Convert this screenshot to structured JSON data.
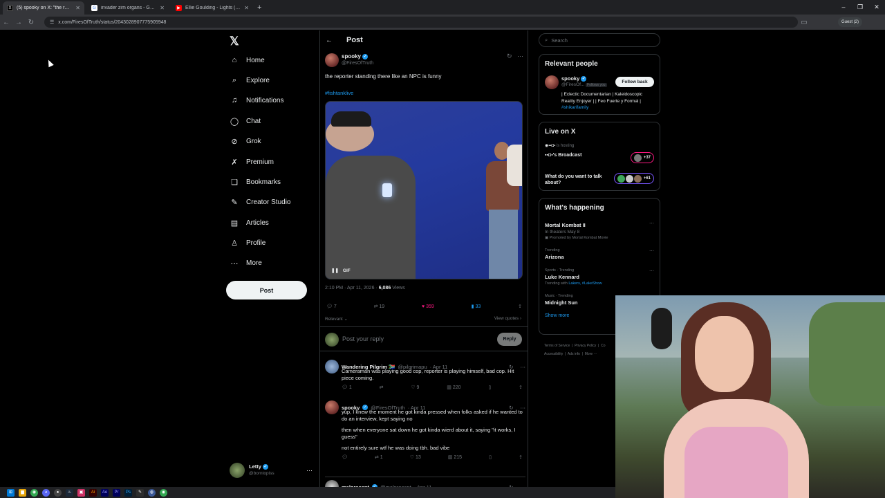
{
  "browser": {
    "tabs": [
      {
        "title": "(5) spooky on X: \"the reporter",
        "icon": "x-favicon",
        "color": "#000000",
        "active": true
      },
      {
        "title": "invader zim organs - Google Se",
        "icon": "google-favicon",
        "color": "#4285f4",
        "active": false
      },
      {
        "title": "Ellie Goulding - Lights (Bassno",
        "icon": "youtube-favicon",
        "color": "#ff0000",
        "active": false
      }
    ],
    "url": "x.com/FiresOfTruth/status/2043028907775905948",
    "profile_label": "Guest (2)"
  },
  "nav": {
    "items": [
      {
        "label": "Home",
        "icon": "home-icon",
        "glyph": "⌂"
      },
      {
        "label": "Explore",
        "icon": "search-icon",
        "glyph": "⌕"
      },
      {
        "label": "Notifications",
        "icon": "bell-icon",
        "glyph": "♫"
      },
      {
        "label": "Chat",
        "icon": "chat-icon",
        "glyph": "◯"
      },
      {
        "label": "Grok",
        "icon": "grok-icon",
        "glyph": "⊘"
      },
      {
        "label": "Premium",
        "icon": "premium-icon",
        "glyph": "✗"
      },
      {
        "label": "Bookmarks",
        "icon": "bookmark-icon",
        "glyph": "❑"
      },
      {
        "label": "Creator Studio",
        "icon": "creator-studio-icon",
        "glyph": "✎"
      },
      {
        "label": "Articles",
        "icon": "articles-icon",
        "glyph": "▤"
      },
      {
        "label": "Profile",
        "icon": "profile-icon",
        "glyph": "♙"
      },
      {
        "label": "More",
        "icon": "more-icon",
        "glyph": "⋯"
      }
    ],
    "post_button": "Post",
    "account": {
      "name": "Letty",
      "handle": "@borntopiss"
    }
  },
  "post": {
    "header_title": "Post",
    "author": {
      "name": "spooky",
      "handle": "@FiresOfTruth"
    },
    "text": "the reporter standing there like an NPC is funny",
    "hashtag": "#fishtanklive",
    "media_label": "GIF",
    "timestamp": "2:10 PM · Apr 11, 2026 ·",
    "views": "6,086",
    "views_label": "Views",
    "stats": {
      "replies": "7",
      "reposts": "19",
      "likes": "359",
      "bookmarks": "33"
    },
    "sort_label": "Relevant",
    "view_quotes": "View quotes",
    "compose_placeholder": "Post your reply",
    "reply_button": "Reply"
  },
  "replies": [
    {
      "name": "Wandering Pilgrim 🇿🇦",
      "handle": "@pilgrimapu",
      "time": "· Apr 11",
      "text": "Cameraman was playing good cop, reporter is playing himself, bad cop. Hit piece coming.",
      "stats": {
        "replies": "1",
        "reposts": "",
        "likes": "9",
        "views": "220"
      }
    },
    {
      "name": "spooky",
      "handle": "@FiresOfTruth",
      "time": "· Apr 11",
      "text": "yup, I knew the moment he got kinda pressed when folks asked if he wanted to do an interview, kept saying no",
      "text2": "then when everyone sat down he got kinda wierd about it, saying \"it works, I guess\"",
      "text3": "not entirely sure wtf he was doing tbh. bad vibe",
      "stats": {
        "replies": "",
        "reposts": "1",
        "likes": "13",
        "views": "215"
      }
    },
    {
      "name": "malpresent",
      "handle": "@malpresent",
      "time": "· Apr 11"
    }
  ],
  "sidebar": {
    "search_placeholder": "Search",
    "relevant": {
      "title": "Relevant people",
      "name": "spooky",
      "handle": "@FiresOf...",
      "follows_you": "Follows you",
      "follow_button": "Follow back",
      "bio": "| Eclectic Documentarian | Kaleidoscopic Reality Enjoyer | | Feo Fuerte y Formal |",
      "bio_tag": "#shikarifamily"
    },
    "live": {
      "title": "Live on X",
      "host_suffix": "is hosting",
      "broadcast": "'s Broadcast",
      "count1": "+37",
      "topic": "What do you want to talk about?",
      "count2": "+61"
    },
    "happening": {
      "title": "What's happening",
      "trends": [
        {
          "meta": "",
          "name": "Mortal Kombat II",
          "sub": "In theaters May 8",
          "promo": "Promoted by Mortal Kombat Movie"
        },
        {
          "meta": "Trending",
          "name": "Arizona"
        },
        {
          "meta": "Sports · Trending",
          "name": "Luke Kennard",
          "with_label": "Trending with",
          "with_tags": "Lakers, #LakeShow"
        },
        {
          "meta": "Music · Trending",
          "name": "Midnight Sun"
        }
      ],
      "show_more": "Show more"
    },
    "footer": {
      "line1": [
        "Terms of Service",
        "Privacy Policy",
        "Co"
      ],
      "line2": [
        "Accessibility",
        "Ads info",
        "More ···"
      ]
    }
  },
  "colors": {
    "accent": "#1d9bf0",
    "like": "#f91880",
    "bg": "#000000",
    "border": "#2f3336"
  }
}
